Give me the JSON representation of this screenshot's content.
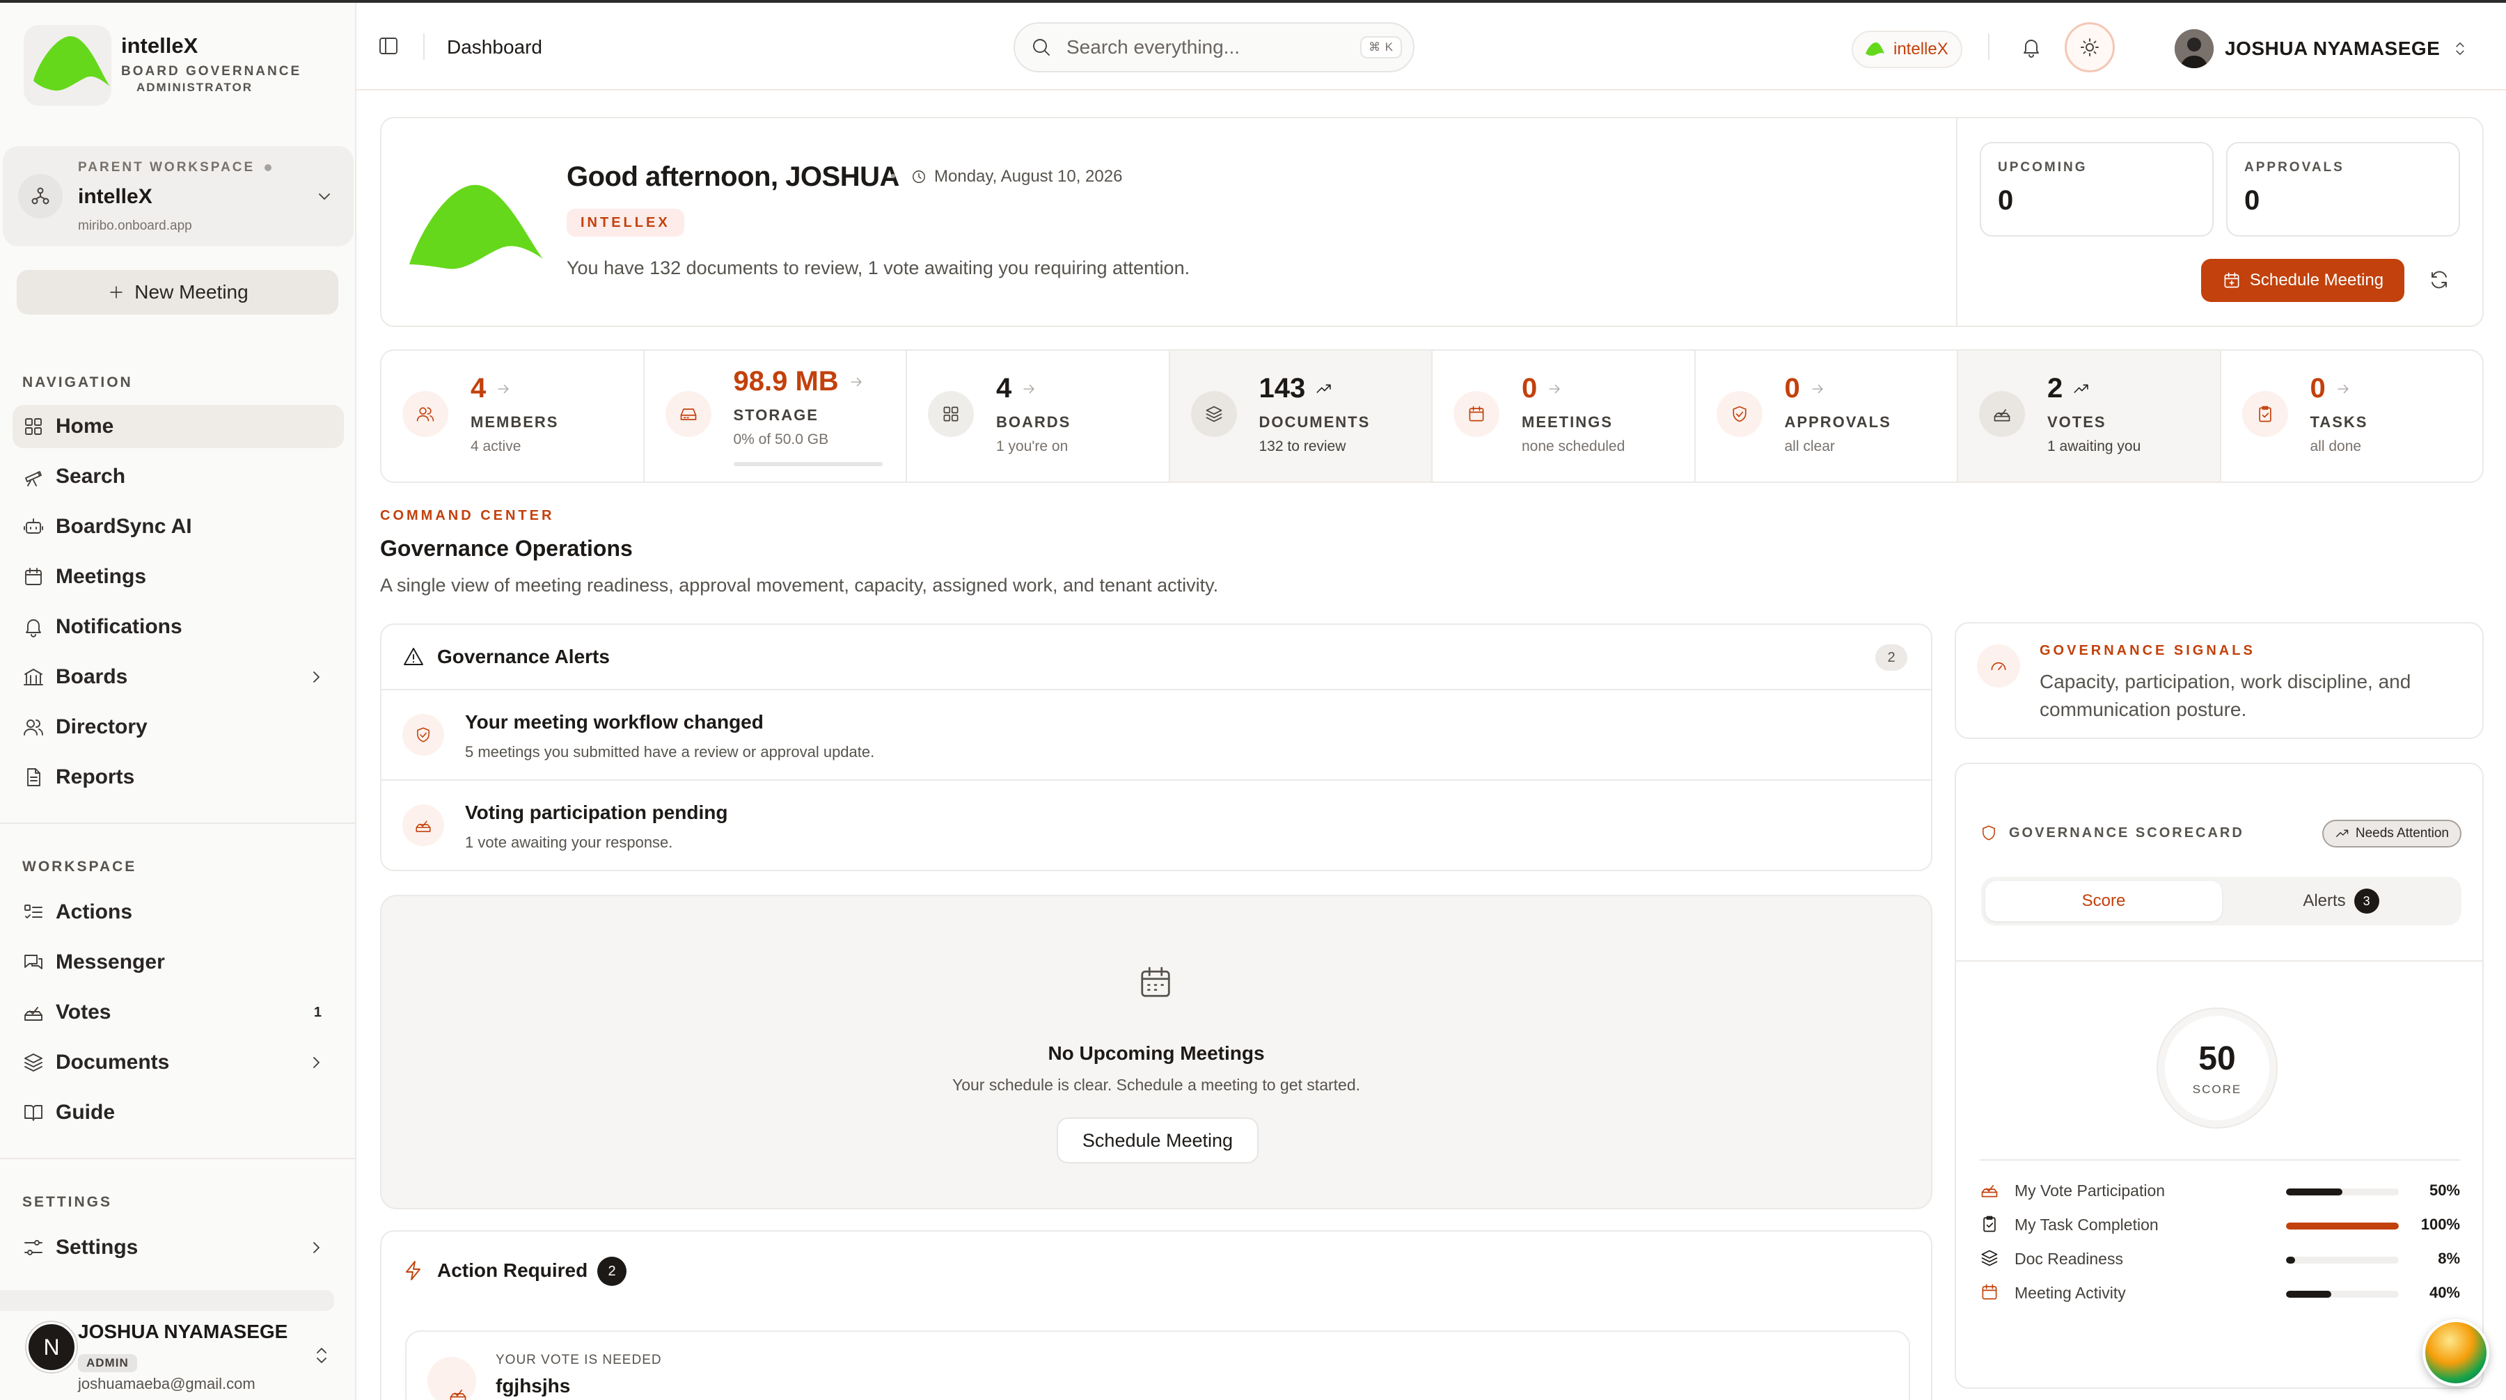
{
  "brand": {
    "name": "intelleX",
    "subtitle": "BOARD GOVERNANCE",
    "role": "ADMINISTRATOR",
    "color": "#65d81b"
  },
  "workspace": {
    "label": "PARENT WORKSPACE",
    "name": "intelleX",
    "url": "miribo.onboard.app"
  },
  "sidebar": {
    "new_meeting": "New Meeting",
    "nav_label": "NAVIGATION",
    "nav": [
      {
        "label": "Home",
        "icon": "home-icon"
      },
      {
        "label": "Search",
        "icon": "telescope-icon"
      },
      {
        "label": "BoardSync AI",
        "icon": "bot-icon"
      },
      {
        "label": "Meetings",
        "icon": "calendar-icon"
      },
      {
        "label": "Notifications",
        "icon": "bell-icon"
      },
      {
        "label": "Boards",
        "icon": "building-icon"
      },
      {
        "label": "Directory",
        "icon": "users-icon"
      },
      {
        "label": "Reports",
        "icon": "file-icon"
      }
    ],
    "workspace_label": "WORKSPACE",
    "workspace_items": [
      {
        "label": "Actions",
        "icon": "list-todo-icon"
      },
      {
        "label": "Messenger",
        "icon": "chat-icon"
      },
      {
        "label": "Votes",
        "icon": "vote-icon",
        "badge": "1"
      },
      {
        "label": "Documents",
        "icon": "layers-icon"
      },
      {
        "label": "Guide",
        "icon": "book-icon"
      }
    ],
    "settings_label": "SETTINGS",
    "settings": {
      "label": "Settings",
      "icon": "sliders-icon"
    },
    "user": {
      "initial": "N",
      "name": "JOSHUA NYAMASEGE",
      "role": "ADMIN",
      "email": "joshuamaeba@gmail.com"
    }
  },
  "topbar": {
    "title": "Dashboard",
    "search_placeholder": "Search everything...",
    "shortcut": "⌘ K",
    "tenant": "intelleX",
    "user": "JOSHUA NYAMASEGE"
  },
  "hero": {
    "greeting": "Good afternoon, JOSHUA",
    "date": "Monday, August 10, 2026",
    "tag": "INTELLEX",
    "message": "You have 132 documents to review, 1 vote awaiting you requiring attention.",
    "upcoming_label": "UPCOMING",
    "upcoming_value": "0",
    "approvals_label": "APPROVALS",
    "approvals_value": "0",
    "schedule": "Schedule Meeting"
  },
  "stats": [
    {
      "value": "4",
      "label": "MEMBERS",
      "sub": "4 active",
      "icon": "users-icon"
    },
    {
      "value": "98.9 MB",
      "label": "STORAGE",
      "sub": "0% of 50.0 GB",
      "icon": "hard-drive-icon",
      "progress": 0
    },
    {
      "value": "4",
      "label": "BOARDS",
      "sub": "1 you're on",
      "icon": "grid-icon"
    },
    {
      "value": "143",
      "label": "DOCUMENTS",
      "sub": "132 to review",
      "icon": "layers-icon"
    },
    {
      "value": "0",
      "label": "MEETINGS",
      "sub": "none scheduled",
      "icon": "calendar-icon"
    },
    {
      "value": "0",
      "label": "APPROVALS",
      "sub": "all clear",
      "icon": "shield-check-icon"
    },
    {
      "value": "2",
      "label": "VOTES",
      "sub": "1 awaiting you",
      "icon": "vote-icon"
    },
    {
      "value": "0",
      "label": "TASKS",
      "sub": "all done",
      "icon": "clipboard-check-icon"
    }
  ],
  "command_center": {
    "eyebrow": "COMMAND CENTER",
    "title": "Governance Operations",
    "description": "A single view of meeting readiness, approval movement, capacity, assigned work, and tenant activity."
  },
  "alerts": {
    "title": "Governance Alerts",
    "count": "2",
    "items": [
      {
        "title": "Your meeting workflow changed",
        "desc": "5 meetings you submitted have a review or approval update."
      },
      {
        "title": "Voting participation pending",
        "desc": "1 vote awaiting your response."
      }
    ]
  },
  "empty": {
    "title": "No Upcoming Meetings",
    "desc": "Your schedule is clear. Schedule a meeting to get started.",
    "button": "Schedule Meeting"
  },
  "action_required": {
    "title": "Action Required",
    "count": "2",
    "item_label": "YOUR VOTE IS NEEDED",
    "item_title": "fgjhsjhs"
  },
  "signals": {
    "eyebrow": "GOVERNANCE SIGNALS",
    "desc": "Capacity, participation, work discipline, and communication posture."
  },
  "scorecard": {
    "title": "GOVERNANCE SCORECARD",
    "status": "Needs Attention",
    "tab_score": "Score",
    "tab_alerts": "Alerts",
    "alerts_count": "3",
    "score": "50",
    "score_label": "SCORE",
    "metrics": [
      {
        "label": "My Vote Participation",
        "value": 50,
        "display": "50%",
        "color": "#1c1917",
        "icon": "vote-icon"
      },
      {
        "label": "My Task Completion",
        "value": 100,
        "display": "100%",
        "color": "#c2410c",
        "icon": "clipboard-check-icon"
      },
      {
        "label": "Doc Readiness",
        "value": 8,
        "display": "8%",
        "color": "#1c1917",
        "icon": "layers-icon"
      },
      {
        "label": "Meeting Activity",
        "value": 40,
        "display": "40%",
        "color": "#1c1917",
        "icon": "calendar-icon"
      }
    ]
  },
  "colors": {
    "accent": "#c2410c",
    "brand_green": "#65d81b"
  }
}
